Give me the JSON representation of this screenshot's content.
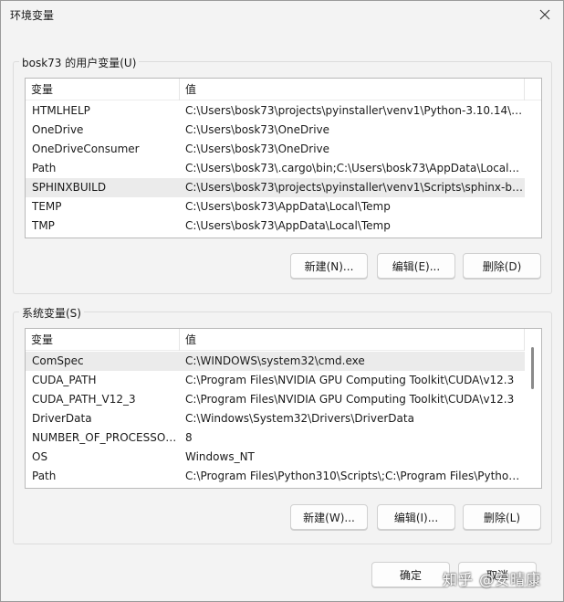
{
  "window": {
    "title": "环境变量"
  },
  "user_vars": {
    "label": "bosk73 的用户变量(U)",
    "headers": {
      "name": "变量",
      "value": "值"
    },
    "rows": [
      {
        "name": "HTMLHELP",
        "value": "C:\\Users\\bosk73\\projects\\pyinstaller\\venv1\\Python-3.10.14\\e..."
      },
      {
        "name": "OneDrive",
        "value": "C:\\Users\\bosk73\\OneDrive"
      },
      {
        "name": "OneDriveConsumer",
        "value": "C:\\Users\\bosk73\\OneDrive"
      },
      {
        "name": "Path",
        "value": "C:\\Users\\bosk73\\.cargo\\bin;C:\\Users\\bosk73\\AppData\\Local..."
      },
      {
        "name": "SPHINXBUILD",
        "value": "C:\\Users\\bosk73\\projects\\pyinstaller\\venv1\\Scripts\\sphinx-bu..."
      },
      {
        "name": "TEMP",
        "value": "C:\\Users\\bosk73\\AppData\\Local\\Temp"
      },
      {
        "name": "TMP",
        "value": "C:\\Users\\bosk73\\AppData\\Local\\Temp"
      }
    ],
    "buttons": {
      "new": "新建(N)...",
      "edit": "编辑(E)...",
      "delete": "删除(D)"
    }
  },
  "system_vars": {
    "label": "系统变量(S)",
    "headers": {
      "name": "变量",
      "value": "值"
    },
    "rows": [
      {
        "name": "ComSpec",
        "value": "C:\\WINDOWS\\system32\\cmd.exe"
      },
      {
        "name": "CUDA_PATH",
        "value": "C:\\Program Files\\NVIDIA GPU Computing Toolkit\\CUDA\\v12.3"
      },
      {
        "name": "CUDA_PATH_V12_3",
        "value": "C:\\Program Files\\NVIDIA GPU Computing Toolkit\\CUDA\\v12.3"
      },
      {
        "name": "DriverData",
        "value": "C:\\Windows\\System32\\Drivers\\DriverData"
      },
      {
        "name": "NUMBER_OF_PROCESSORS",
        "value": "8"
      },
      {
        "name": "OS",
        "value": "Windows_NT"
      },
      {
        "name": "Path",
        "value": "C:\\Program Files\\Python310\\Scripts\\;C:\\Program Files\\Python..."
      }
    ],
    "buttons": {
      "new": "新建(W)...",
      "edit": "编辑(I)...",
      "delete": "删除(L)"
    }
  },
  "footer": {
    "ok": "确定",
    "cancel": "取消"
  },
  "watermark": "知乎 @安晴康",
  "icons": {
    "close": "close-icon"
  },
  "colors": {
    "selected_row": "#ebebeb",
    "scroll_thumb": "#8a8a8a"
  }
}
